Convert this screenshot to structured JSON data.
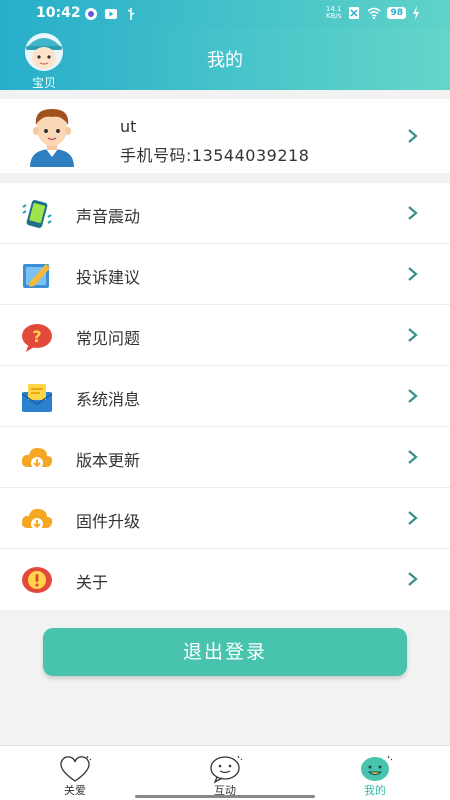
{
  "status_bar": {
    "time": "10:42",
    "net_speed_top": "14.1",
    "net_speed_unit": "KB/s",
    "battery": "98"
  },
  "header": {
    "title": "我的",
    "baby_label": "宝贝"
  },
  "profile": {
    "name": "ut",
    "phone": "手机号码:13544039218"
  },
  "menu": [
    {
      "label": "声音震动",
      "icon": "phone-vibrate-icon"
    },
    {
      "label": "投诉建议",
      "icon": "edit-feedback-icon"
    },
    {
      "label": "常见问题",
      "icon": "question-bubble-icon"
    },
    {
      "label": "系统消息",
      "icon": "mail-message-icon"
    },
    {
      "label": "版本更新",
      "icon": "cloud-download-icon"
    },
    {
      "label": "固件升级",
      "icon": "cloud-download-icon"
    },
    {
      "label": "关于",
      "icon": "alert-info-icon"
    }
  ],
  "logout_label": "退出登录",
  "tabs": [
    {
      "label": "关爱",
      "icon": "heart-icon",
      "active": false
    },
    {
      "label": "互动",
      "icon": "chat-face-icon",
      "active": false
    },
    {
      "label": "我的",
      "icon": "smile-face-icon",
      "active": true
    }
  ],
  "colors": {
    "accent": "#48c3ad",
    "header_start": "#27aeca",
    "header_end": "#64d6c9",
    "chevron": "#3a8f8b"
  }
}
